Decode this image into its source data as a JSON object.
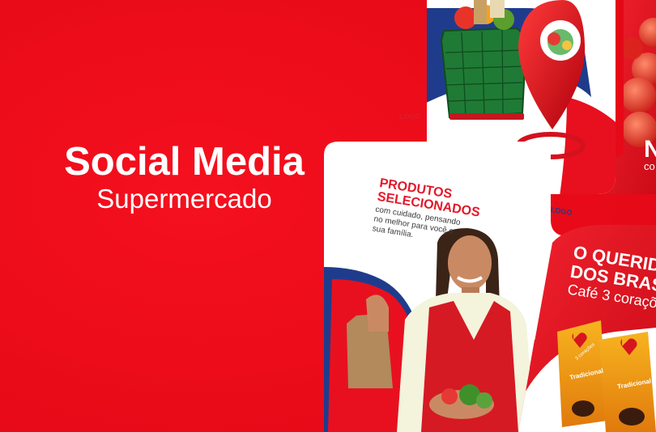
{
  "hero": {
    "title": "Social Media",
    "subtitle": "Supermercado"
  },
  "post_top": {
    "logo": "LOGO"
  },
  "post_middle": {
    "logo": "LOGO",
    "heading_line1": "PRODUTOS",
    "heading_line2": "SELECIONADOS",
    "body_lines": [
      "com cuidado, pensando",
      "no melhor para você e",
      "sua família."
    ]
  },
  "post_right_top": {
    "partial_letter": "N",
    "partial_word": "co"
  },
  "post_right_bottom": {
    "heading_line1": "O QUERID",
    "heading_line2": "DOS BRAS",
    "sub": "Café 3 coraçõe",
    "package_brand": "3 corações",
    "package_label": "Tradicional"
  },
  "colors": {
    "brand_red": "#e8101f",
    "brand_blue": "#1f3c8c",
    "white": "#ffffff"
  }
}
